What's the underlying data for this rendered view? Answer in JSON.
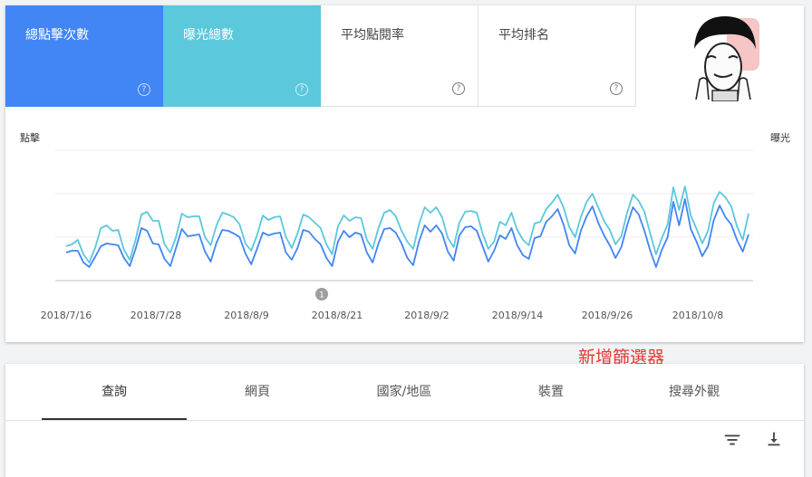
{
  "metrics": [
    {
      "label": "總點擊次數",
      "help": "?"
    },
    {
      "label": "曝光總數",
      "help": "?"
    },
    {
      "label": "平均點閱率",
      "help": "?"
    },
    {
      "label": "平均排名",
      "help": "?"
    }
  ],
  "chart": {
    "left_axis_label": "點擊",
    "right_axis_label": "曝光",
    "annotation_marker": "1",
    "x_ticks": [
      "2018/7/16",
      "2018/7/28",
      "2018/8/9",
      "2018/8/21",
      "2018/9/2",
      "2018/9/14",
      "2018/9/26",
      "2018/10/8"
    ]
  },
  "chart_data": {
    "type": "line",
    "x": [
      "2018/7/16",
      "2018/7/28",
      "2018/8/9",
      "2018/8/21",
      "2018/9/2",
      "2018/9/14",
      "2018/9/26",
      "2018/10/8"
    ],
    "series": [
      {
        "name": "總點擊次數",
        "color": "#4285f4",
        "values": [
          31,
          33,
          33,
          20,
          15,
          26,
          38,
          41,
          40,
          39,
          25,
          16,
          35,
          58,
          55,
          41,
          40,
          24,
          16,
          36,
          57,
          49,
          50,
          51,
          32,
          21,
          42,
          56,
          55,
          52,
          48,
          30,
          18,
          35,
          53,
          50,
          52,
          53,
          31,
          23,
          36,
          56,
          54,
          46,
          40,
          25,
          16,
          43,
          55,
          48,
          53,
          51,
          31,
          20,
          41,
          57,
          58,
          53,
          41,
          25,
          17,
          43,
          61,
          54,
          61,
          52,
          32,
          22,
          50,
          59,
          60,
          55,
          38,
          21,
          33,
          50,
          46,
          58,
          39,
          28,
          24,
          47,
          49,
          65,
          71,
          79,
          62,
          39,
          30,
          55,
          71,
          82,
          64,
          50,
          39,
          25,
          37,
          61,
          81,
          73,
          55,
          33,
          15,
          34,
          48,
          87,
          61,
          90,
          57,
          43,
          27,
          38,
          67,
          83,
          70,
          62,
          45,
          32,
          51
        ]
      },
      {
        "name": "曝光總數",
        "color": "#5bc8dc",
        "values": [
          38,
          40,
          45,
          29,
          20,
          36,
          58,
          61,
          55,
          56,
          34,
          23,
          45,
          73,
          76,
          66,
          66,
          40,
          31,
          48,
          74,
          70,
          71,
          71,
          48,
          39,
          61,
          75,
          73,
          70,
          62,
          41,
          33,
          50,
          72,
          67,
          70,
          71,
          48,
          36,
          52,
          73,
          70,
          64,
          58,
          40,
          29,
          60,
          72,
          66,
          70,
          69,
          45,
          35,
          58,
          75,
          78,
          71,
          55,
          43,
          35,
          62,
          81,
          75,
          81,
          70,
          47,
          37,
          64,
          76,
          77,
          75,
          52,
          35,
          43,
          65,
          61,
          75,
          56,
          45,
          39,
          63,
          65,
          79,
          86,
          95,
          81,
          59,
          48,
          70,
          87,
          96,
          81,
          66,
          56,
          40,
          49,
          75,
          95,
          88,
          76,
          52,
          29,
          47,
          62,
          103,
          78,
          104,
          72,
          57,
          41,
          55,
          86,
          98,
          92,
          82,
          60,
          45,
          74
        ]
      }
    ],
    "grid": true
  },
  "tabs": [
    "查詢",
    "網頁",
    "國家/地區",
    "裝置",
    "搜尋外觀"
  ],
  "annotation": "新增篩選器",
  "icons": {
    "filter": "filter-icon",
    "download": "download-icon"
  },
  "colors": {
    "clicks": "#4285f4",
    "impressions": "#5bc8dc",
    "annotation": "#e53935"
  }
}
